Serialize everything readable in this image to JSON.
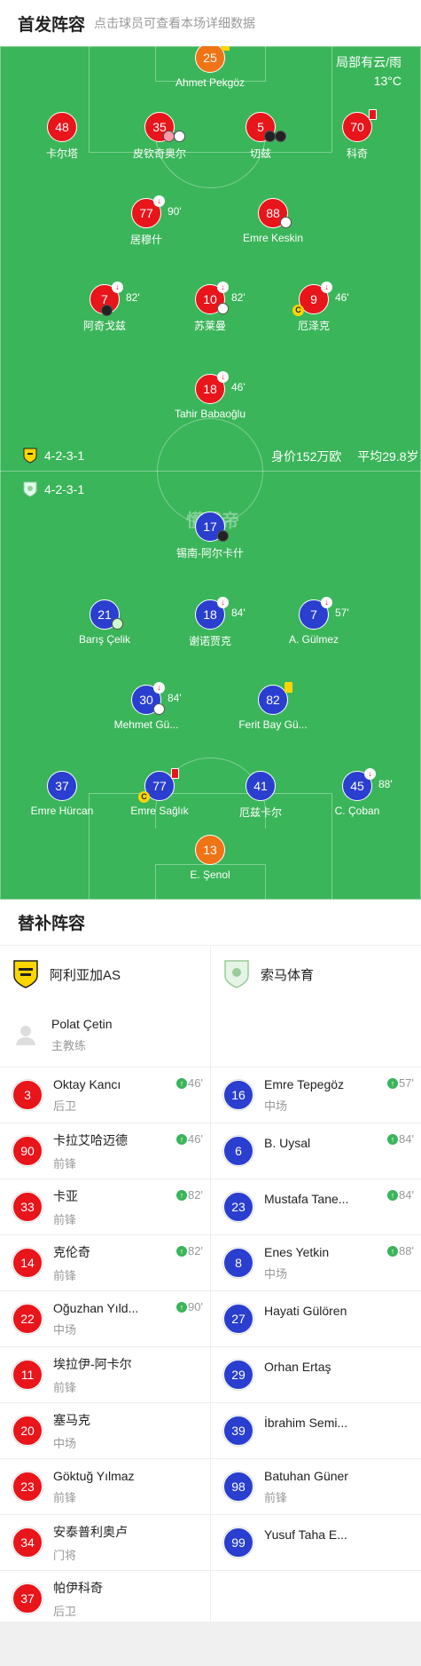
{
  "header": {
    "title": "首发阵容",
    "subtitle": "点击球员可查看本场详细数据"
  },
  "pitch": {
    "weather": "局部有云/雨",
    "temperature": "13°C",
    "watermark": "懂球帝",
    "home_formation": "4-2-3-1",
    "away_formation": "4-2-3-1",
    "value_info": "身价152万欧",
    "age_info": "平均29.8岁",
    "home_players": [
      {
        "number": "25",
        "name": "Ahmet Pekgöz",
        "color": "orange"
      },
      {
        "number": "48",
        "name": "卡尔塔"
      },
      {
        "number": "35",
        "name": "皮钦奇奥尔"
      },
      {
        "number": "5",
        "name": "切兹"
      },
      {
        "number": "70",
        "name": "科奇"
      },
      {
        "number": "77",
        "name": "居穆什",
        "sub_time": "90'"
      },
      {
        "number": "88",
        "name": "Emre Keskin"
      },
      {
        "number": "7",
        "name": "阿奇戈兹",
        "sub_time": "82'"
      },
      {
        "number": "10",
        "name": "苏莱曼",
        "sub_time": "82'"
      },
      {
        "number": "9",
        "name": "厄泽克",
        "sub_time": "46'"
      },
      {
        "number": "18",
        "name": "Tahir Babaoğlu",
        "sub_time": "46'"
      }
    ],
    "away_players": [
      {
        "number": "17",
        "name": "锡南-阿尔卡什"
      },
      {
        "number": "21",
        "name": "Barış Çelik"
      },
      {
        "number": "18",
        "name": "谢诺贾克",
        "sub_time": "84'"
      },
      {
        "number": "7",
        "name": "A. Gülmez",
        "sub_time": "57'"
      },
      {
        "number": "30",
        "name": "Mehmet Gü...",
        "sub_time": "84'"
      },
      {
        "number": "82",
        "name": "Ferit Bay Gü..."
      },
      {
        "number": "37",
        "name": "Emre Hürcan"
      },
      {
        "number": "77",
        "name": "Emre Sağlık"
      },
      {
        "number": "41",
        "name": "厄兹卡尔"
      },
      {
        "number": "45",
        "name": "C. Çoban",
        "sub_time": "88'"
      },
      {
        "number": "13",
        "name": "E. Şenol",
        "color": "orange"
      }
    ]
  },
  "subs": {
    "title": "替补阵容",
    "home_team": "阿利亚加AS",
    "away_team": "索马体育",
    "coach": {
      "name": "Polat Çetin",
      "role": "主教练"
    },
    "home": [
      {
        "number": "3",
        "name": "Oktay Kancı",
        "pos": "后卫",
        "in": "46'"
      },
      {
        "number": "90",
        "name": "卡拉艾哈迈德",
        "pos": "前锋",
        "in": "46'"
      },
      {
        "number": "33",
        "name": "卡亚",
        "pos": "前锋",
        "in": "82'"
      },
      {
        "number": "14",
        "name": "克伦奇",
        "pos": "前锋",
        "in": "82'"
      },
      {
        "number": "22",
        "name": "Oğuzhan Yıld...",
        "pos": "中场",
        "in": "90'"
      },
      {
        "number": "11",
        "name": "埃拉伊-阿卡尔",
        "pos": "前锋"
      },
      {
        "number": "20",
        "name": "塞马克",
        "pos": "中场"
      },
      {
        "number": "23",
        "name": "Göktuğ Yılmaz",
        "pos": "前锋"
      },
      {
        "number": "34",
        "name": "安泰普利奥卢",
        "pos": "门将"
      },
      {
        "number": "37",
        "name": "帕伊科奇",
        "pos": "后卫"
      }
    ],
    "away": [
      {
        "number": "16",
        "name": "Emre Tepegöz",
        "pos": "中场",
        "in": "57'"
      },
      {
        "number": "6",
        "name": "B. Uysal",
        "pos": "",
        "in": "84'"
      },
      {
        "number": "23",
        "name": "Mustafa Tane...",
        "pos": "",
        "in": "84'"
      },
      {
        "number": "8",
        "name": "Enes Yetkin",
        "pos": "中场",
        "in": "88'"
      },
      {
        "number": "27",
        "name": "Hayati Gülören",
        "pos": ""
      },
      {
        "number": "29",
        "name": "Orhan Ertaş",
        "pos": ""
      },
      {
        "number": "39",
        "name": "İbrahim Semi...",
        "pos": ""
      },
      {
        "number": "98",
        "name": "Batuhan Güner",
        "pos": "前锋"
      },
      {
        "number": "99",
        "name": "Yusuf Taha E...",
        "pos": ""
      }
    ]
  },
  "colors": {
    "pitch": "#3bb55a",
    "home": "#e8151b",
    "away": "#2a3fcf",
    "keeper": "#f07316"
  }
}
